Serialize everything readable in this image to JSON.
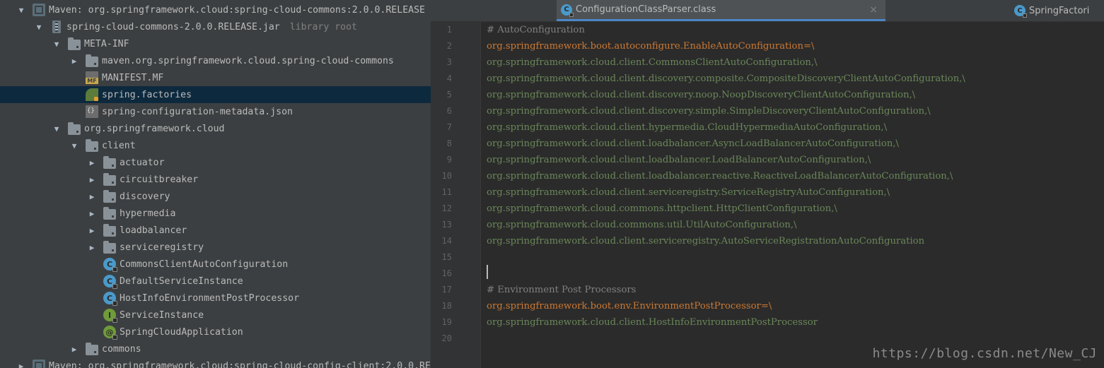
{
  "tree": {
    "rows": [
      {
        "label": "Maven: org.springframework.cloud:spring-cloud-commons:2.0.0.RELEASE",
        "hint": ""
      },
      {
        "label": "spring-cloud-commons-2.0.0.RELEASE.jar",
        "hint": "library root"
      },
      {
        "label": "META-INF",
        "hint": ""
      },
      {
        "label": "maven.org.springframework.cloud.spring-cloud-commons",
        "hint": ""
      },
      {
        "label": "MANIFEST.MF",
        "hint": ""
      },
      {
        "label": "spring.factories",
        "hint": ""
      },
      {
        "label": "spring-configuration-metadata.json",
        "hint": ""
      },
      {
        "label": "org.springframework.cloud",
        "hint": ""
      },
      {
        "label": "client",
        "hint": ""
      },
      {
        "label": "actuator",
        "hint": ""
      },
      {
        "label": "circuitbreaker",
        "hint": ""
      },
      {
        "label": "discovery",
        "hint": ""
      },
      {
        "label": "hypermedia",
        "hint": ""
      },
      {
        "label": "loadbalancer",
        "hint": ""
      },
      {
        "label": "serviceregistry",
        "hint": ""
      },
      {
        "label": "CommonsClientAutoConfiguration",
        "hint": ""
      },
      {
        "label": "DefaultServiceInstance",
        "hint": ""
      },
      {
        "label": "HostInfoEnvironmentPostProcessor",
        "hint": ""
      },
      {
        "label": "ServiceInstance",
        "hint": ""
      },
      {
        "label": "SpringCloudApplication",
        "hint": ""
      },
      {
        "label": "commons",
        "hint": ""
      },
      {
        "label": "Maven: org.springframework.cloud:spring-cloud-config-client:2.0.0.RE",
        "hint": ""
      }
    ],
    "icon_glyphs": {
      "class": "C",
      "interface": "I",
      "annotation": "@",
      "json": "{}",
      "manifest": "MF"
    },
    "selected_color": "#0d293e"
  },
  "editor": {
    "tabs": [
      {
        "label": "ConfigurationClassParser.class",
        "icon": "class-icon"
      },
      {
        "label": "SpringFactori",
        "icon": "class-icon"
      }
    ],
    "close_glyph": "×",
    "line_numbers": [
      "1",
      "2",
      "3",
      "4",
      "5",
      "6",
      "7",
      "8",
      "9",
      "10",
      "11",
      "12",
      "13",
      "14",
      "15",
      "16",
      "17",
      "18",
      "19",
      "20"
    ],
    "lines": [
      "# AutoConfiguration",
      "org.springframework.boot.autoconfigure.EnableAutoConfiguration=\\",
      "org.springframework.cloud.client.CommonsClientAutoConfiguration,\\",
      "org.springframework.cloud.client.discovery.composite.CompositeDiscoveryClientAutoConfiguration,\\",
      "org.springframework.cloud.client.discovery.noop.NoopDiscoveryClientAutoConfiguration,\\",
      "org.springframework.cloud.client.discovery.simple.SimpleDiscoveryClientAutoConfiguration,\\",
      "org.springframework.cloud.client.hypermedia.CloudHypermediaAutoConfiguration,\\",
      "org.springframework.cloud.client.loadbalancer.AsyncLoadBalancerAutoConfiguration,\\",
      "org.springframework.cloud.client.loadbalancer.LoadBalancerAutoConfiguration,\\",
      "org.springframework.cloud.client.loadbalancer.reactive.ReactiveLoadBalancerAutoConfiguration,\\",
      "org.springframework.cloud.client.serviceregistry.ServiceRegistryAutoConfiguration,\\",
      "org.springframework.cloud.commons.httpclient.HttpClientConfiguration,\\",
      "org.springframework.cloud.commons.util.UtilAutoConfiguration,\\",
      "org.springframework.cloud.client.serviceregistry.AutoServiceRegistrationAutoConfiguration",
      "",
      "",
      "# Environment Post Processors",
      "org.springframework.boot.env.EnvironmentPostProcessor=\\",
      "org.springframework.cloud.client.HostInfoEnvironmentPostProcessor",
      ""
    ],
    "colors": {
      "comment": "#808080",
      "key": "#cc7832",
      "value": "#6a8759"
    }
  },
  "watermark": "https://blog.csdn.net/New_CJ"
}
